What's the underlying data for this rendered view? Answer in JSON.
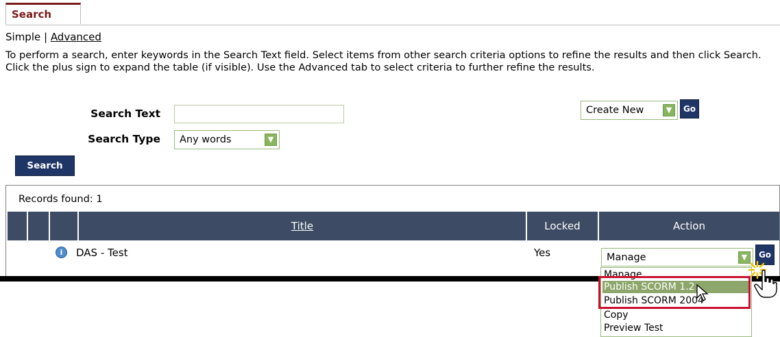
{
  "tab": {
    "label": "Search"
  },
  "mode": {
    "simple": "Simple",
    "separator": " | ",
    "advanced": "Advanced"
  },
  "description": "To perform a search, enter keywords in the Search Text field. Select items from other search criteria options to refine the results and then click Search. Click the plus sign to expand the table (if visible). Use the Advanced tab to select criteria to further refine the results.",
  "search": {
    "text_label": "Search Text",
    "text_value": "",
    "type_label": "Search Type",
    "type_value": "Any words",
    "button": "Search"
  },
  "create": {
    "value": "Create New",
    "go": "Go"
  },
  "results": {
    "records": "Records found: 1",
    "columns": {
      "title": "Title",
      "locked": "Locked",
      "action": "Action"
    },
    "rows": [
      {
        "title": "DAS - Test",
        "locked": "Yes",
        "action": "Manage",
        "go": "Go"
      }
    ]
  },
  "action_menu": {
    "options": [
      "Manage",
      "Publish SCORM 1.2",
      "Publish SCORM 2004",
      "Copy",
      "Preview Test"
    ],
    "highlighted": "Publish SCORM 1.2"
  },
  "colors": {
    "tab_accent": "#7a1a1a",
    "header_bg": "#3d4b64",
    "button_bg": "#1f3566",
    "highlight": "#c8102e"
  }
}
